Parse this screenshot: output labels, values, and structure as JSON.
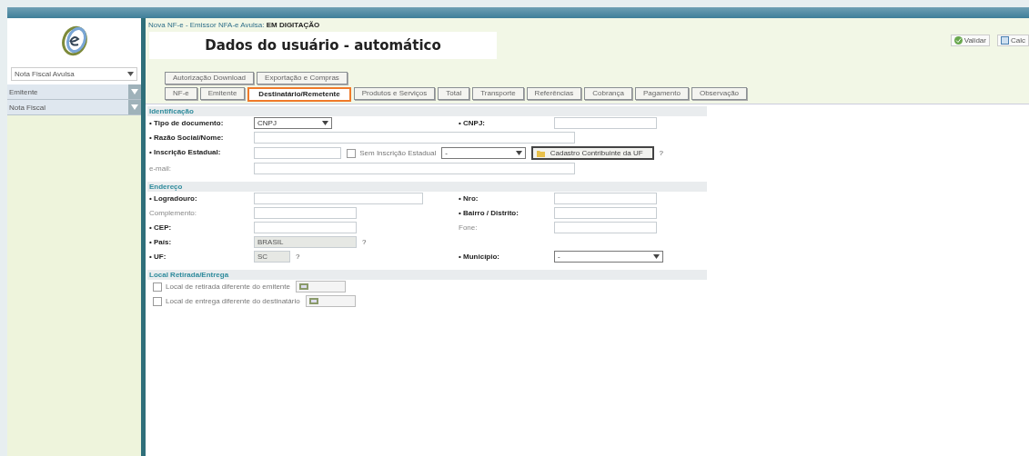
{
  "sidebar": {
    "module_select": "Nota Fiscal Avulsa",
    "items": [
      {
        "label": "Emitente"
      },
      {
        "label": "Nota Fiscal"
      }
    ]
  },
  "header": {
    "title": "Nova NF-e - Emissor NFA-e Avulsa:",
    "status": "EM DIGITAÇÃO",
    "overlay_note": "Dados do usuário - automático",
    "actions": [
      {
        "label": "Validar",
        "kind": "check"
      },
      {
        "label": "Calc",
        "kind": "doc"
      }
    ]
  },
  "tabs_row_1": [
    {
      "label": "Autorização Download",
      "selected": false
    },
    {
      "label": "Exportação e Compras",
      "selected": false
    }
  ],
  "tabs_row_2": [
    {
      "label": "NF-e",
      "selected": false
    },
    {
      "label": "Emitente",
      "selected": false
    },
    {
      "label": "Destinatário/Remetente",
      "selected": true
    },
    {
      "label": "Produtos e Serviços",
      "selected": false
    },
    {
      "label": "Total",
      "selected": false
    },
    {
      "label": "Transporte",
      "selected": false
    },
    {
      "label": "Referências",
      "selected": false
    },
    {
      "label": "Cobrança",
      "selected": false
    },
    {
      "label": "Pagamento",
      "selected": false
    },
    {
      "label": "Observação",
      "selected": false
    }
  ],
  "sections": [
    {
      "title": "Identificação",
      "rows": [
        {
          "label": "• Tipo de documento:",
          "required": true,
          "controls": [
            {
              "kind": "select",
              "value": "CNPJ"
            }
          ],
          "label_2": "• CNPJ:",
          "required_2": true,
          "controls_2": [
            {
              "kind": "input"
            }
          ]
        },
        {
          "label": "• Razão Social/Nome:",
          "required": true,
          "controls": [
            {
              "kind": "input-long"
            }
          ]
        },
        {
          "label": "• Inscrição Estadual:",
          "required": true,
          "controls": [
            {
              "kind": "input"
            },
            {
              "kind": "checkbox",
              "label": "Sem Inscrição Estadual",
              "checked": false
            },
            {
              "kind": "select-medium",
              "value": "-"
            },
            {
              "kind": "button",
              "label": "Cadastro Contribuinte da UF"
            },
            {
              "kind": "help",
              "label": "?"
            }
          ]
        },
        {
          "label": "e-mail:",
          "required": false,
          "controls": [
            {
              "kind": "input-long"
            }
          ]
        }
      ]
    },
    {
      "title": "Endereço",
      "rows": [
        {
          "label": "• Logradouro:",
          "required": true,
          "controls": [
            {
              "kind": "input-medium"
            }
          ],
          "label_2": "• Nro:",
          "required_2": true,
          "controls_2": [
            {
              "kind": "input"
            }
          ]
        },
        {
          "label": "Complemento:",
          "required": false,
          "controls": [
            {
              "kind": "input"
            }
          ],
          "label_2": "• Bairro / Distrito:",
          "required_2": true,
          "controls_2": [
            {
              "kind": "input"
            }
          ]
        },
        {
          "label": "• CEP:",
          "required": true,
          "controls": [
            {
              "kind": "input"
            }
          ],
          "label_2": "Fone:",
          "required_2": false,
          "controls_2": [
            {
              "kind": "input"
            }
          ]
        },
        {
          "label": "• País:",
          "required": true,
          "controls": [
            {
              "kind": "input",
              "value": "BRASIL",
              "disabled": true
            },
            {
              "kind": "help",
              "label": "?"
            }
          ]
        },
        {
          "label": "• UF:",
          "required": true,
          "controls": [
            {
              "kind": "input-tiny",
              "value": "SC",
              "disabled": true
            },
            {
              "kind": "help",
              "label": "?"
            }
          ],
          "label_2": "• Município:",
          "required_2": true,
          "controls_2": [
            {
              "kind": "select-wide",
              "value": "-"
            }
          ]
        }
      ]
    },
    {
      "title": "Local Retirada/Entrega",
      "rows": [
        {
          "controls": [
            {
              "kind": "checkbox",
              "label": "Local de retirada diferente do emitente",
              "checked": false
            },
            {
              "kind": "picker"
            }
          ]
        },
        {
          "controls": [
            {
              "kind": "checkbox",
              "label": "Local de entrega diferente do destinatário",
              "checked": false
            },
            {
              "kind": "picker"
            }
          ]
        }
      ]
    }
  ]
}
